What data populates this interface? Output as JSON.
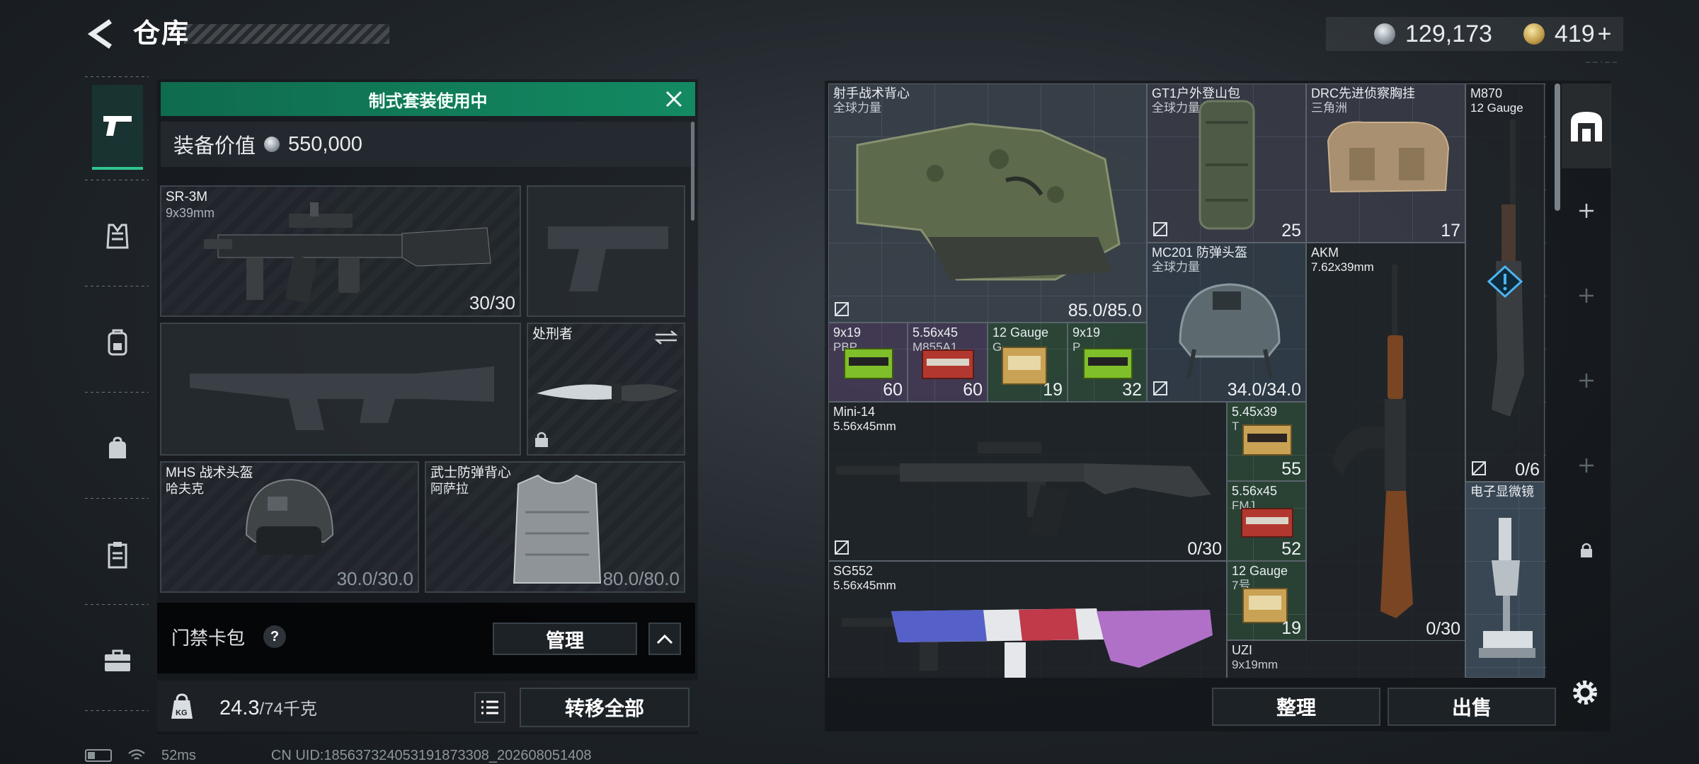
{
  "header": {
    "title": "仓库",
    "currency": {
      "silver": "129,173",
      "gold": "419",
      "gold_plus": "+"
    },
    "version": "– – · – –"
  },
  "left_nav": {
    "items": [
      {
        "id": "weapons",
        "icon": "pistol-icon",
        "active": true
      },
      {
        "id": "armor",
        "icon": "vest-icon"
      },
      {
        "id": "backpack",
        "icon": "backpack-icon"
      },
      {
        "id": "bag",
        "icon": "bag-icon"
      },
      {
        "id": "clipboard",
        "icon": "clipboard-icon"
      },
      {
        "id": "case",
        "icon": "briefcase-icon"
      }
    ]
  },
  "loadout": {
    "banner": "制式套装使用中",
    "equip_value_label": "装备价值",
    "equip_value": "550,000",
    "slots": {
      "primary": {
        "name": "SR-3M",
        "caliber": "9x39mm",
        "ammo": "30/30"
      },
      "melee": {
        "name": "处刑者"
      },
      "helmet": {
        "name": "MHS 战术头盔",
        "sub": "哈夫克",
        "durability": "30.0/30.0"
      },
      "vest": {
        "name": "武士防弹背心",
        "sub": "阿萨拉",
        "durability": "80.0/80.0"
      }
    },
    "card_pack": {
      "label": "门禁卡包",
      "help": "?",
      "manage": "管理"
    },
    "weight": {
      "current": "24.3",
      "max": "/74千克"
    },
    "transfer_all": "转移全部"
  },
  "status": {
    "ping": "52ms",
    "uid": "CN UID:185637324053191873308_202608051408"
  },
  "storage": {
    "items": [
      {
        "key": "rig",
        "name": "射手战术背心",
        "sub": "全球力量",
        "count": "85.0/85.0"
      },
      {
        "key": "gt1",
        "name": "GT1户外登山包",
        "sub": "全球力量",
        "count": "25"
      },
      {
        "key": "drc",
        "name": "DRC先进侦察胸挂",
        "sub": "三角洲",
        "count": "17"
      },
      {
        "key": "m870",
        "name": "M870",
        "sub": "12 Gauge",
        "count": "0/6"
      },
      {
        "key": "mc201",
        "name": "MC201 防弹头盔",
        "sub": "全球力量",
        "count": "34.0/34.0"
      },
      {
        "key": "akm",
        "name": "AKM",
        "sub": "7.62x39mm",
        "count": "0/30"
      },
      {
        "key": "ammo1",
        "name": "9x19",
        "sub": "PBP",
        "count": "60"
      },
      {
        "key": "ammo2",
        "name": "5.56x45",
        "sub": "M855A1",
        "count": "60"
      },
      {
        "key": "ammo3",
        "name": "12 Gauge",
        "sub": "G",
        "count": "19"
      },
      {
        "key": "ammo4",
        "name": "9x19",
        "sub": "P",
        "count": "32"
      },
      {
        "key": "mini14",
        "name": "Mini-14",
        "sub": "5.56x45mm",
        "count": "0/30"
      },
      {
        "key": "ammo5",
        "name": "5.45x39",
        "sub": "T",
        "count": "55"
      },
      {
        "key": "ammo6",
        "name": "5.56x45",
        "sub": "FMJ",
        "count": "52"
      },
      {
        "key": "microscope",
        "name": "电子显微镜",
        "sub": "",
        "count": ""
      },
      {
        "key": "sg552",
        "name": "SG552",
        "sub": "5.56x45mm",
        "count": ""
      },
      {
        "key": "ammo7",
        "name": "12 Gauge",
        "sub": "7号",
        "count": "19"
      },
      {
        "key": "uzi",
        "name": "UZI",
        "sub": "9x19mm",
        "count": ""
      }
    ],
    "tidy": "整理",
    "sell": "出售"
  },
  "colors": {
    "accent_green": "#138a62",
    "ammo_green": "#7fbf2a",
    "ammo_red": "#b2382f",
    "ammo_tan": "#c9a255"
  }
}
